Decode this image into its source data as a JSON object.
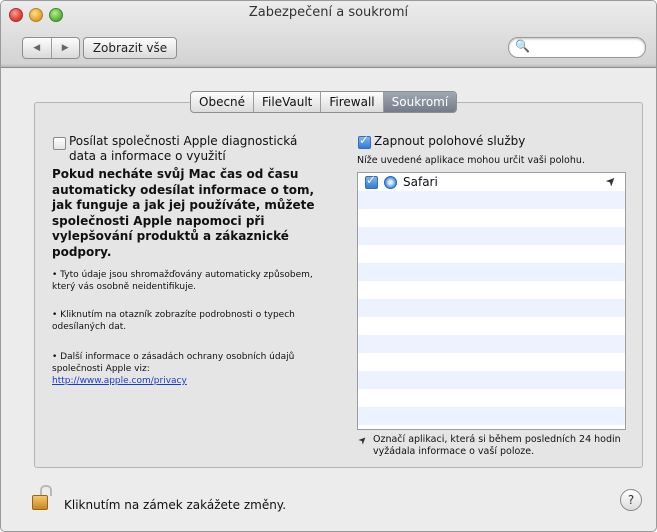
{
  "window": {
    "title": "Zabezpečení a soukromí"
  },
  "toolbar": {
    "back_glyph": "◀",
    "forward_glyph": "▶",
    "show_all_label": "Zobrazit vše",
    "search_placeholder": "",
    "search_glyph": "🔍"
  },
  "tabs": [
    {
      "label": "Obecné",
      "active": false
    },
    {
      "label": "FileVault",
      "active": false
    },
    {
      "label": "Firewall",
      "active": false
    },
    {
      "label": "Soukromí",
      "active": true
    }
  ],
  "left": {
    "diagnostics_checkbox_label": "Posílat společnosti Apple diagnostická data a informace o využití",
    "diagnostics_checked": false,
    "bold_text": "Pokud necháte svůj Mac čas od času automaticky odesílat informace o tom, jak funguje a jak jej používáte, můžete společnosti Apple napomoci při vylepšování produktů a zákaznické podpory.",
    "bullet1": "• Tyto údaje jsou shromažďovány automaticky způsobem, který vás osobně neidentifikuje.",
    "bullet2": "• Kliknutím na otazník zobrazíte podrobnosti o typech odesílaných dat.",
    "bullet3": "• Další informace o zásadách ochrany osobních údajů společnosti Apple viz:",
    "privacy_link": "http://www.apple.com/privacy"
  },
  "right": {
    "location_checkbox_label": "Zapnout polohové služby",
    "location_checked": true,
    "subtitle": "Níže uvedené aplikace mohou určit vaši polohu.",
    "apps": [
      {
        "name": "Safari",
        "checked": true,
        "recent_glyph": "➤"
      }
    ],
    "note_glyph": "➤",
    "note": "Označí aplikaci, která si během posledních 24 hodin vyžádala informace o vaší poloze."
  },
  "footer": {
    "lock_label": "Kliknutím na zámek zakážete změny.",
    "help_label": "?"
  },
  "colors": {
    "tab_active": "#7d8692",
    "checkbox_on": "#2f7bdd",
    "link": "#1a3ccc",
    "list_stripe": "#edf3fe"
  }
}
